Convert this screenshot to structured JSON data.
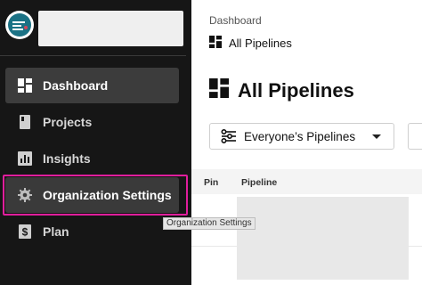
{
  "sidebar": {
    "items": [
      {
        "label": "Dashboard",
        "icon": "dashboard-icon",
        "state": "active"
      },
      {
        "label": "Projects",
        "icon": "projects-icon",
        "state": "default"
      },
      {
        "label": "Insights",
        "icon": "insights-icon",
        "state": "default"
      },
      {
        "label": "Organization Settings",
        "icon": "gear-icon",
        "state": "hover"
      },
      {
        "label": "Plan",
        "icon": "dollar-icon",
        "state": "default"
      }
    ],
    "tooltip": "Organization Settings"
  },
  "main": {
    "breadcrumb": "Dashboard",
    "subtitle": "All Pipelines",
    "title": "All Pipelines",
    "filter_label": "Everyone’s Pipelines",
    "table": {
      "columns": [
        "Pin",
        "Pipeline"
      ]
    }
  },
  "colors": {
    "sidebar_bg": "#161616",
    "highlight": "#e01e9c",
    "logo": "#1b7285"
  }
}
